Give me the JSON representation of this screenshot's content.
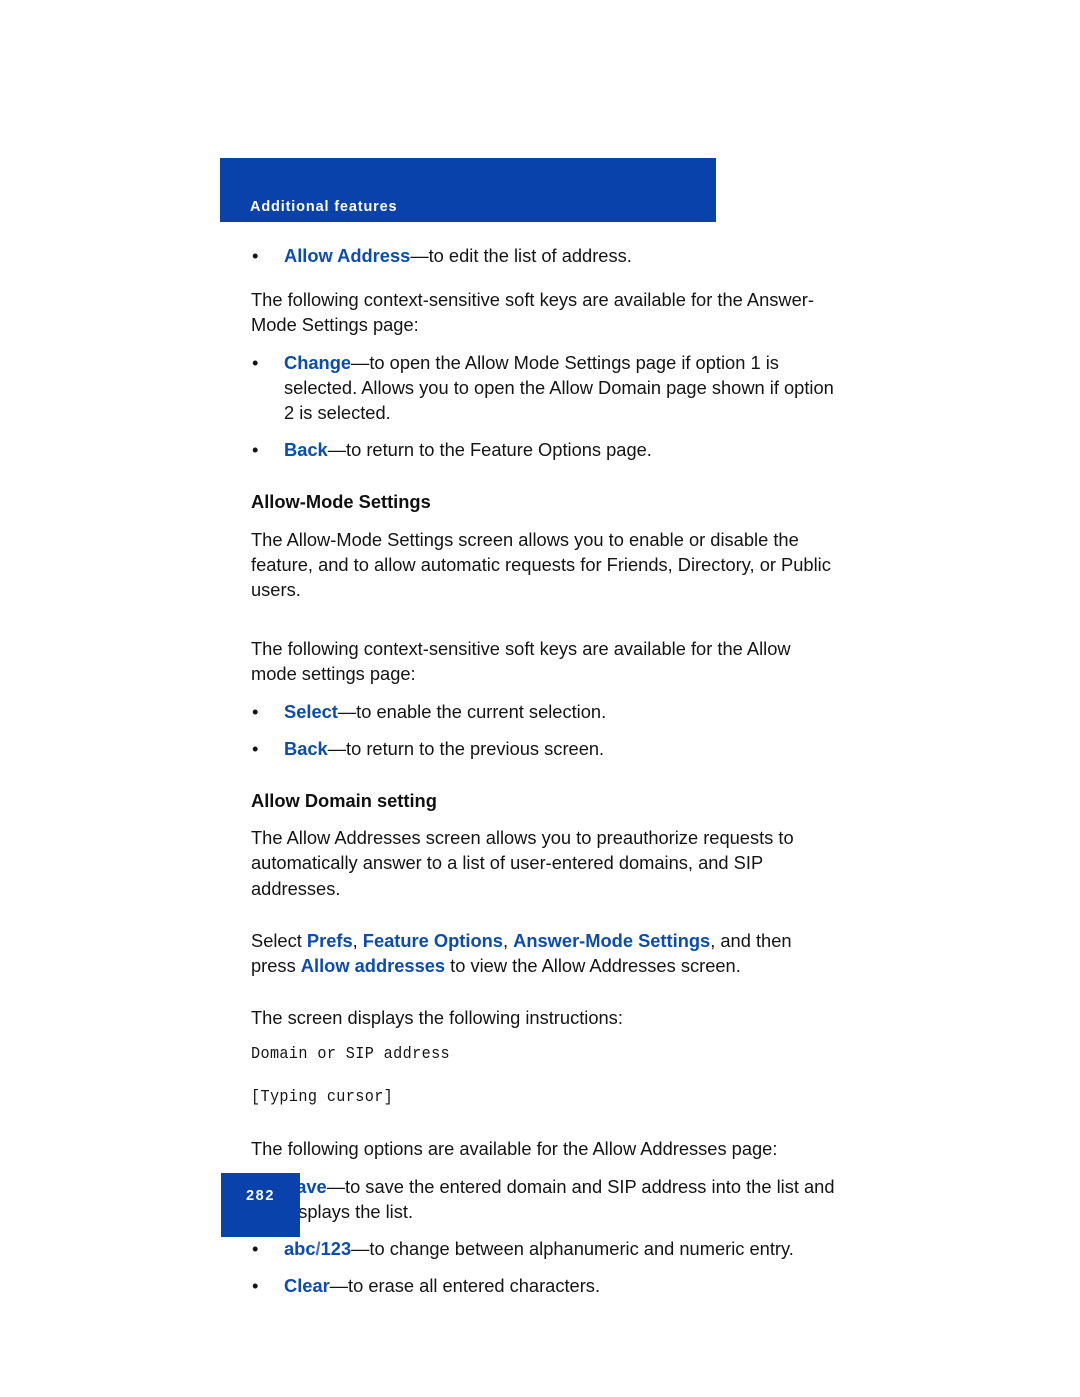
{
  "document": {
    "header_banner": {
      "title": "Additional features"
    },
    "page_number": "282",
    "colors": {
      "banner_blue": "#0942ab",
      "link_blue": "#0b4cad",
      "body_text": "#141414",
      "background": "#ffffff"
    }
  },
  "blocks": {
    "bullet_allow_address": {
      "keyword": "Allow Address",
      "dash": "—",
      "text": "to edit the list of address."
    },
    "para_answer_mode_intro": "The following context-sensitive soft keys are available for the Answer-Mode Settings page:",
    "bullet_change": {
      "keyword": "Change",
      "dash": "—",
      "text": "to open the Allow Mode Settings page if option 1 is selected. Allows you to open the Allow Domain page shown if option 2 is selected."
    },
    "bullet_back_feature_options": {
      "keyword": "Back",
      "dash": "—",
      "text": "to return to the Feature Options page."
    },
    "heading_allow_mode_settings": "Allow-Mode Settings",
    "para_allow_mode_settings": "The Allow-Mode Settings screen allows you to enable or disable the feature, and to allow automatic requests for Friends, Directory, or Public users.",
    "para_allow_mode_softkeys_intro": "The following context-sensitive soft keys are available for the Allow mode settings page:",
    "bullet_select": {
      "keyword": "Select",
      "dash": "—",
      "text": "to enable the current selection."
    },
    "bullet_back_previous_screen": {
      "keyword": "Back",
      "dash": "—",
      "text": "to return to the previous screen."
    },
    "heading_allow_domain_setting": "Allow Domain setting",
    "para_allow_addresses_screen": "The Allow Addresses screen allows you to preauthorize requests to automatically answer to a list of user-entered domains, and SIP addresses.",
    "para_navigation": {
      "lead": "Select ",
      "kw1": "Prefs",
      "sep1": ", ",
      "kw2": "Feature Options",
      "sep2": ", ",
      "kw3": "Answer-Mode Settings",
      "mid": ", and then press ",
      "kw4": "Allow addresses",
      "tail": " to view the Allow Addresses screen."
    },
    "para_screen_displays": "The screen displays the following instructions:",
    "screen_line_domain": "Domain or SIP address",
    "screen_line_cursor": "[Typing cursor]",
    "para_options_intro": "The following options are available for the Allow Addresses page:",
    "bullet_save": {
      "keyword": "Save",
      "dash": "—",
      "text": "to save the entered domain and SIP address into the list and displays the list."
    },
    "bullet_abc123": {
      "keyword_abc": "abc",
      "keyword_slash": "/",
      "keyword_123": "123",
      "dash": "—",
      "text": "to change between alphanumeric and numeric entry."
    },
    "bullet_clear": {
      "keyword": "Clear",
      "dash": "—",
      "text": "to erase all entered characters."
    },
    "bullet_marker": "•"
  }
}
